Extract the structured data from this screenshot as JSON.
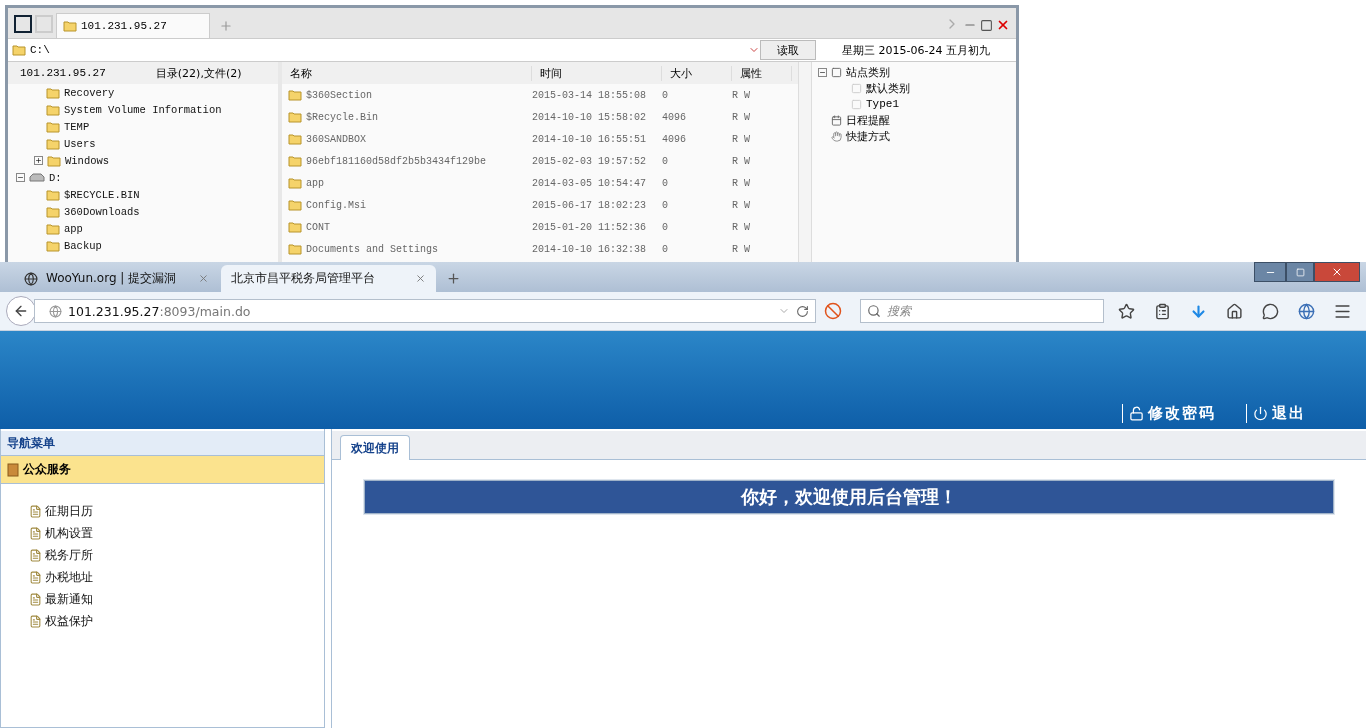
{
  "file_manager": {
    "tabs": [
      {
        "label": "101.231.95.27",
        "selected": true
      }
    ],
    "path": "C:\\",
    "read_button": "读取",
    "date": "星期三 2015-06-24 五月初九",
    "tree_header": {
      "host": "101.231.95.27",
      "summary": "目录(22),文件(2)"
    },
    "tree": [
      {
        "kind": "hidden-parent",
        "children": [
          {
            "label": "Recovery",
            "kind": "folder"
          },
          {
            "label": "System Volume Information",
            "kind": "folder"
          },
          {
            "label": "TEMP",
            "kind": "folder"
          },
          {
            "label": "Users",
            "kind": "folder"
          },
          {
            "label": "Windows",
            "kind": "folder",
            "expanded": false
          }
        ]
      },
      {
        "label": "D:",
        "kind": "drive",
        "expanded": true,
        "children": [
          {
            "label": "$RECYCLE.BIN",
            "kind": "folder"
          },
          {
            "label": "360Downloads",
            "kind": "folder"
          },
          {
            "label": "app",
            "kind": "folder"
          },
          {
            "label": "Backup",
            "kind": "folder"
          }
        ]
      }
    ],
    "columns": [
      "名称",
      "时间",
      "大小",
      "属性"
    ],
    "rows": [
      {
        "name": "$360Section",
        "time": "2015-03-14 18:55:08",
        "size": "0",
        "attr": "R W"
      },
      {
        "name": "$Recycle.Bin",
        "time": "2014-10-10 15:58:02",
        "size": "4096",
        "attr": "R W"
      },
      {
        "name": "360SANDBOX",
        "time": "2014-10-10 16:55:51",
        "size": "4096",
        "attr": "R W"
      },
      {
        "name": "96ebf181160d58df2b5b3434f129be",
        "time": "2015-02-03 19:57:52",
        "size": "0",
        "attr": "R W"
      },
      {
        "name": "app",
        "time": "2014-03-05 10:54:47",
        "size": "0",
        "attr": "R W"
      },
      {
        "name": "Config.Msi",
        "time": "2015-06-17 18:02:23",
        "size": "0",
        "attr": "R W"
      },
      {
        "name": "CONT",
        "time": "2015-01-20 11:52:36",
        "size": "0",
        "attr": "R W"
      },
      {
        "name": "Documents and Settings",
        "time": "2014-10-10 16:32:38",
        "size": "0",
        "attr": "R W"
      }
    ],
    "side_tree": [
      {
        "label": "站点类别",
        "kind": "category",
        "expanded": true,
        "children": [
          {
            "label": "默认类别",
            "kind": "item"
          },
          {
            "label": "Type1",
            "kind": "item"
          }
        ]
      },
      {
        "label": "日程提醒",
        "kind": "schedule"
      },
      {
        "label": "快捷方式",
        "kind": "shortcut"
      }
    ]
  },
  "browser": {
    "tabs": [
      {
        "title": "WooYun.org | 提交漏洞",
        "selected": false
      },
      {
        "title": "北京市昌平税务局管理平台",
        "selected": true
      }
    ],
    "url_host": "101.231.95.27",
    "url_rest": ":8093/main.do",
    "search_placeholder": "搜索"
  },
  "page": {
    "header_links": [
      {
        "label": "修改密码",
        "kind": "password"
      },
      {
        "label": "退出",
        "kind": "logout"
      }
    ],
    "nav_title": "导航菜单",
    "nav_groups": [
      {
        "label": "公众服务",
        "expanded": true,
        "children": [
          {
            "label": "征期日历"
          },
          {
            "label": "机构设置"
          },
          {
            "label": "税务厅所"
          },
          {
            "label": "办税地址"
          },
          {
            "label": "最新通知"
          },
          {
            "label": "权益保护"
          }
        ]
      }
    ],
    "content_tabs": [
      {
        "label": "欢迎使用",
        "selected": true
      }
    ],
    "banner": "你好，欢迎使用后台管理！"
  }
}
